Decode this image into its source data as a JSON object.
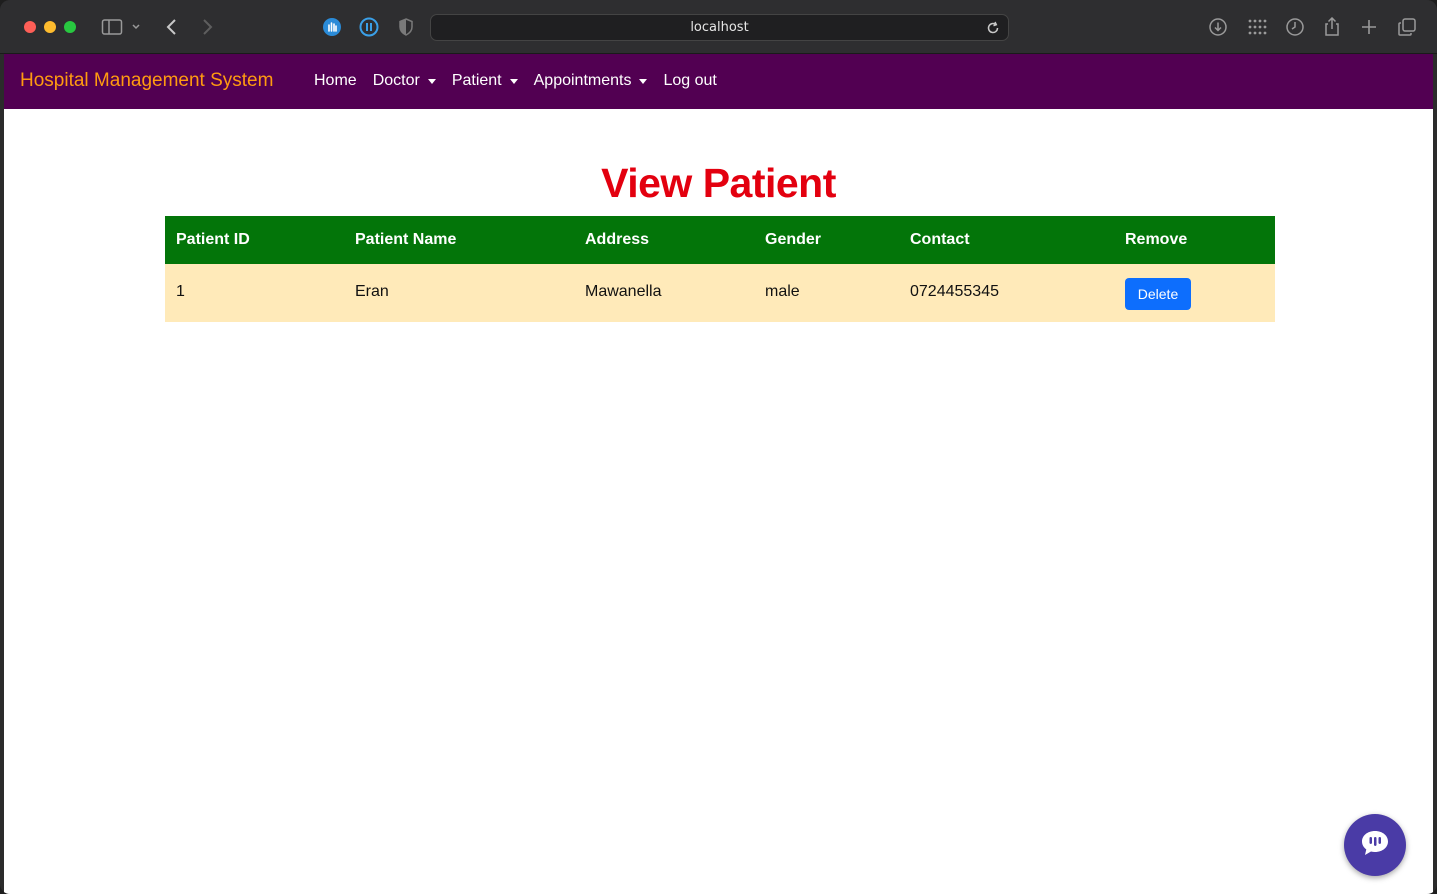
{
  "browser": {
    "url": "localhost"
  },
  "navbar": {
    "brand": "Hospital Management System",
    "items": [
      {
        "label": "Home",
        "dropdown": false
      },
      {
        "label": "Doctor",
        "dropdown": true
      },
      {
        "label": "Patient",
        "dropdown": true
      },
      {
        "label": "Appointments",
        "dropdown": true
      },
      {
        "label": "Log out",
        "dropdown": false
      }
    ]
  },
  "page": {
    "title": "View Patient"
  },
  "table": {
    "headers": [
      "Patient ID",
      "Patient Name",
      "Address",
      "Gender",
      "Contact",
      "Remove"
    ],
    "rows": [
      {
        "id": "1",
        "name": "Eran",
        "address": "Mawanella",
        "gender": "male",
        "contact": "0724455345",
        "action": "Delete"
      }
    ]
  },
  "colors": {
    "navbar_bg": "#520052",
    "brand": "#ff9b10",
    "title": "#e3000f",
    "table_header_bg": "#037509",
    "table_row_bg": "#ffeab9",
    "delete_button": "#0d6efd",
    "chat_button": "#4a3ba6"
  },
  "icons": {
    "chrome": [
      "sidebar-icon",
      "chevron-down-icon",
      "back-icon",
      "forward-icon",
      "extension-hand-icon",
      "extension-pause-icon",
      "shield-icon",
      "reload-icon",
      "download-icon",
      "grid-icon",
      "history-icon",
      "share-icon",
      "new-tab-icon",
      "tabs-overview-icon"
    ],
    "page": [
      "chat-icon"
    ]
  }
}
